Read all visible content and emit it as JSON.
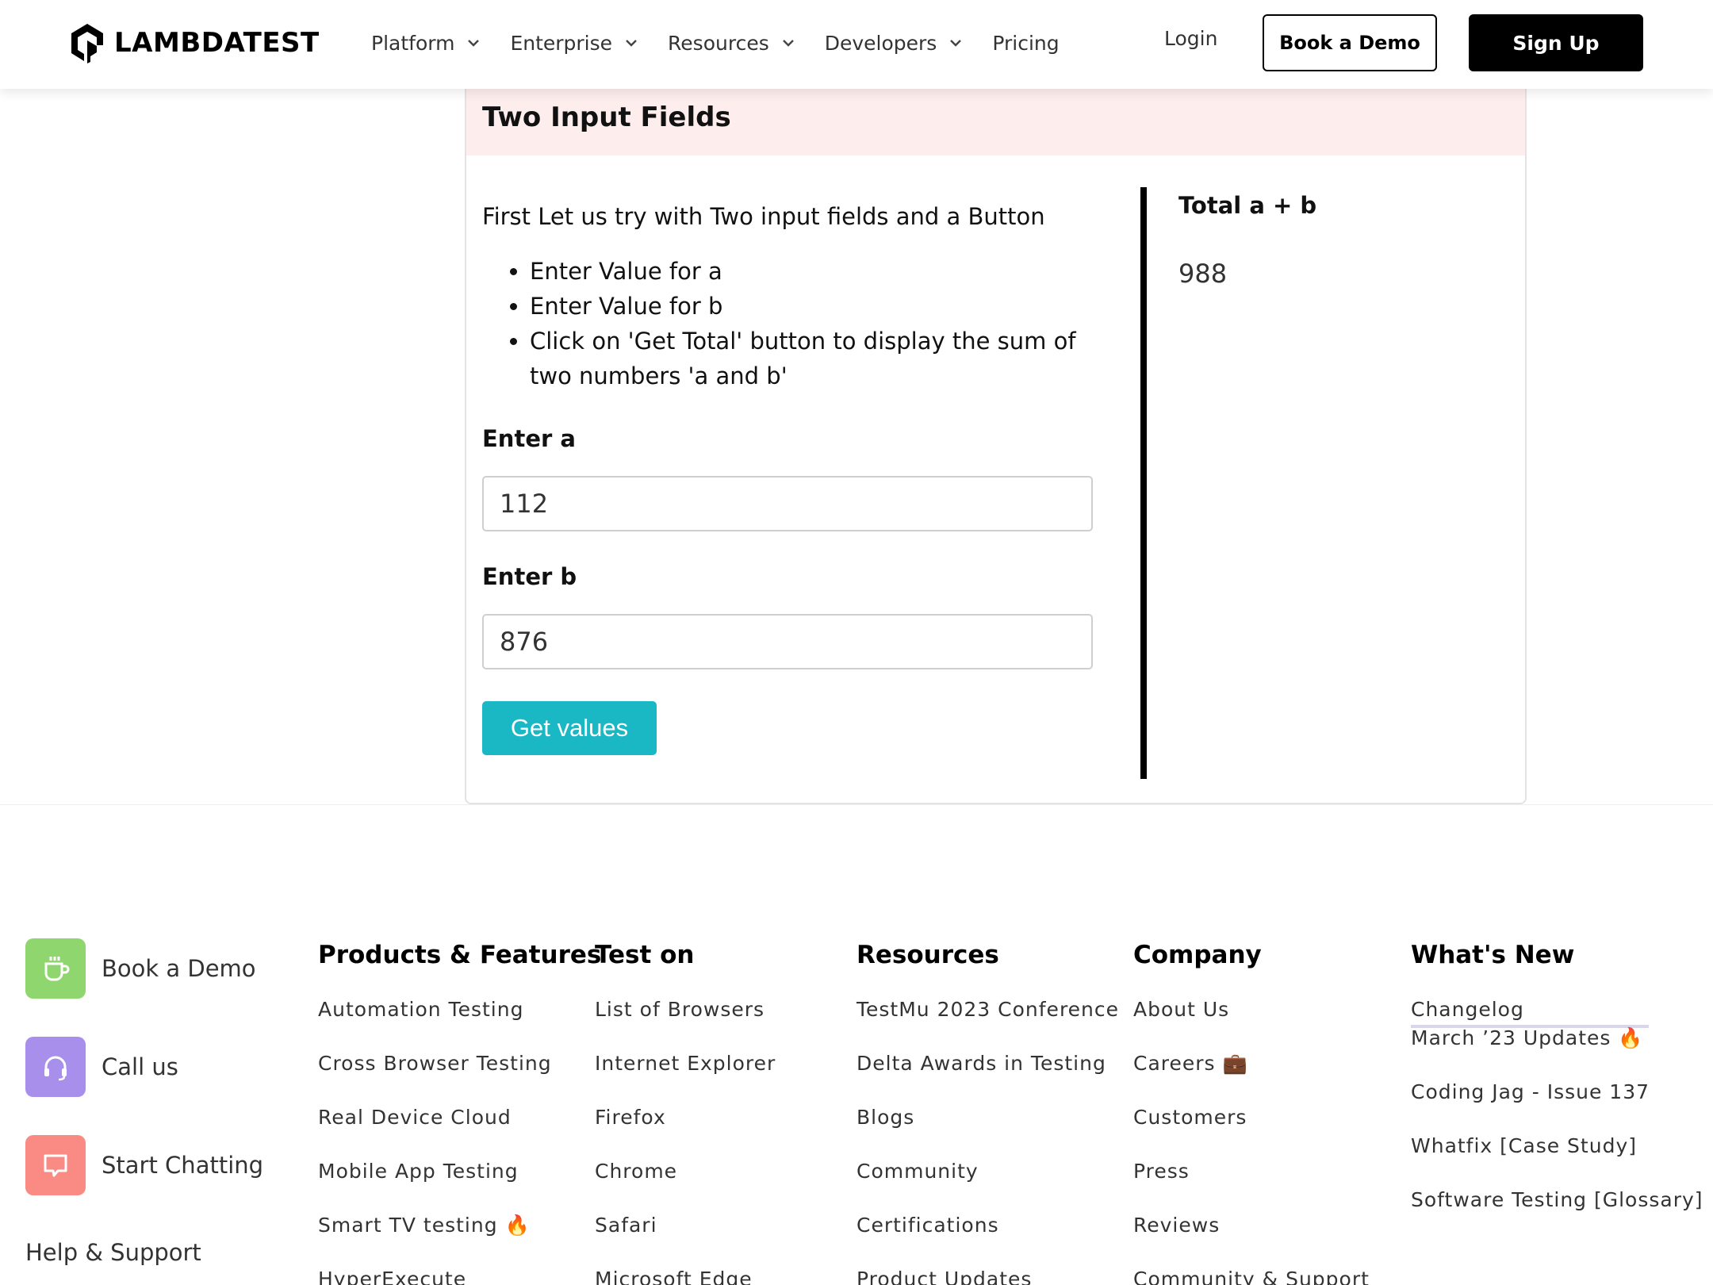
{
  "header": {
    "logo_text": "LAMBDATEST",
    "nav": [
      {
        "label": "Platform",
        "has_dropdown": true
      },
      {
        "label": "Enterprise",
        "has_dropdown": true
      },
      {
        "label": "Resources",
        "has_dropdown": true
      },
      {
        "label": "Developers",
        "has_dropdown": true
      },
      {
        "label": "Pricing",
        "has_dropdown": false
      }
    ],
    "login_label": "Login",
    "book_demo_label": "Book a Demo",
    "signup_label": "Sign Up"
  },
  "card": {
    "title": "Two Input Fields",
    "intro": "First Let us try with Two input fields and a Button",
    "steps": [
      "Enter Value for a",
      "Enter Value for b",
      "Click on 'Get Total' button to display the sum of two numbers 'a and b'"
    ],
    "label_a": "Enter a",
    "value_a": "112",
    "label_b": "Enter b",
    "value_b": "876",
    "button_label": "Get values",
    "total_label": "Total a + b",
    "total_value": "988"
  },
  "footer": {
    "contacts": [
      {
        "label": "Book a Demo",
        "icon": "coffee-cup-icon",
        "color": "#8fd66e"
      },
      {
        "label": "Call us",
        "icon": "headset-icon",
        "color": "#a98fec"
      },
      {
        "label": "Start Chatting",
        "icon": "chat-bubble-icon",
        "color": "#f98b84"
      }
    ],
    "help_label": "Help & Support",
    "columns": [
      {
        "title": "Products & Features",
        "items": [
          "Automation Testing",
          "Cross Browser Testing",
          "Real Device Cloud",
          "Mobile App Testing",
          "Smart TV testing 🔥",
          "HyperExecute"
        ]
      },
      {
        "title": "Test on",
        "items": [
          "List of Browsers",
          "Internet Explorer",
          "Firefox",
          "Chrome",
          "Safari",
          "Microsoft Edge"
        ]
      },
      {
        "title": "Resources",
        "items": [
          "TestMu 2023 Conference",
          "Delta Awards in Testing",
          "Blogs",
          "Community",
          "Certifications",
          "Product Updates"
        ]
      },
      {
        "title": "Company",
        "items": [
          "About Us",
          "Careers 💼",
          "Customers",
          "Press",
          "Reviews",
          "Community & Support"
        ]
      },
      {
        "title": "What's New",
        "items": [
          "Changelog",
          "March ’23 Updates 🔥",
          "Coding Jag - Issue 137",
          "Whatfix [Case Study]",
          "Software Testing [Glossary]"
        ]
      }
    ]
  }
}
